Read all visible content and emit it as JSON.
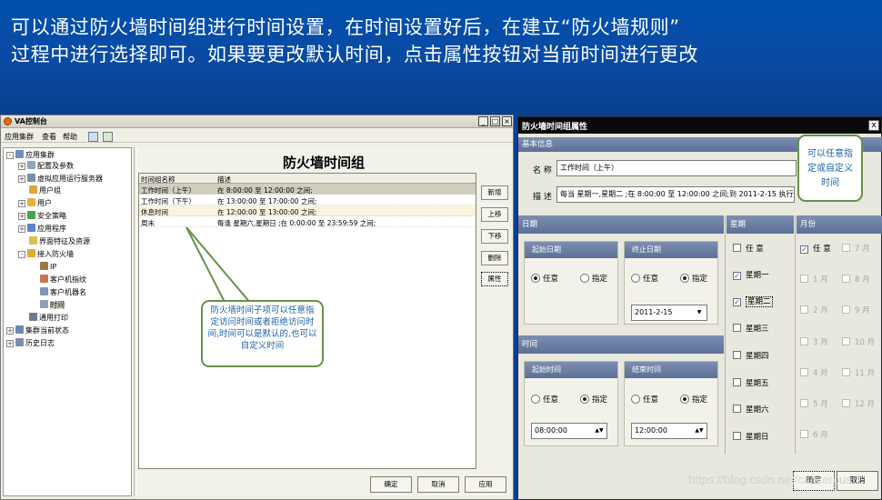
{
  "slide": {
    "line1": "可以通过防火墙时间组进行时间设置，在时间设置好后，在建立“防火墙规则”",
    "line2": "过程中进行选择即可。如果要更改默认时间，点击属性按钮对当前时间进行更改"
  },
  "console": {
    "title": "VA控制台",
    "window_buttons": {
      "min": "_",
      "max": "□",
      "close": "×"
    },
    "menu": [
      "应用集群",
      "查看",
      "帮助"
    ],
    "tree": [
      {
        "label": "应用集群"
      },
      {
        "label": "配置及参数"
      },
      {
        "label": "虚拟应用运行服务器"
      },
      {
        "label": "用户组"
      },
      {
        "label": "用户"
      },
      {
        "label": "安全策略"
      },
      {
        "label": "应用程序"
      },
      {
        "label": "界面特征及资源"
      },
      {
        "label": "接入防火墙"
      },
      {
        "label": "IP"
      },
      {
        "label": "客户机指纹"
      },
      {
        "label": "客户机器名"
      },
      {
        "label": "时间"
      },
      {
        "label": "通用打印"
      },
      {
        "label": "集群当前状态"
      },
      {
        "label": "历史日志"
      }
    ],
    "panel_title": "防火墙时间组",
    "columns": [
      "时间组名称",
      "描述"
    ],
    "rows": [
      {
        "name": "工作时间（上午）",
        "desc": "在 8:00:00 至 12:00:00 之间;"
      },
      {
        "name": "工作时间（下午）",
        "desc": "在 13:00:00 至 17:00:00 之间;"
      },
      {
        "name": "休息时间",
        "desc": "在 12:00:00 至 13:00:00 之间;"
      },
      {
        "name": "周末",
        "desc": "每逢 星期六,星期日 ;在 0:00:00 至 23:59:59 之间;"
      }
    ],
    "side_buttons": [
      "新增",
      "上移",
      "下移",
      "删除",
      "属性"
    ],
    "bottom_buttons": [
      "确定",
      "取消",
      "应用"
    ],
    "callout": "防火墙时间子项可以任意指定访问时间或者拒绝访问时间,时间可以是默认的,也可以自定义时间"
  },
  "dialog": {
    "title": "防火墙时间组属性",
    "close": "x",
    "basic_section": "基本信息",
    "name_label": "名 称",
    "name_value": "工作时间（上午）",
    "desc_label": "描 述",
    "desc_value": "每当 星期一,星期二 ;在 8:00:00 至 12:00:00 之间;到 2011-2-15 执行结束;",
    "date_section": "日期",
    "start_date_group": "起始日期",
    "end_date_group": "终止日期",
    "time_section": "时间",
    "start_time_group": "起始时间",
    "end_time_group": "结束时间",
    "opt_any": "任意",
    "opt_specify": "指定",
    "end_date_value": "2011-2-15",
    "start_time_value": "08:00:00",
    "end_time_value": "12:00:00",
    "week_section": "星期",
    "weekdays": [
      {
        "label": "任 意",
        "checked": false
      },
      {
        "label": "星期一",
        "checked": true
      },
      {
        "label": "星期二",
        "checked": true
      },
      {
        "label": "星期三",
        "checked": false
      },
      {
        "label": "星期四",
        "checked": false
      },
      {
        "label": "星期五",
        "checked": false
      },
      {
        "label": "星期六",
        "checked": false
      },
      {
        "label": "星期日",
        "checked": false
      }
    ],
    "month_section": "月份",
    "months_col1": [
      {
        "label": "任 意",
        "checked": true
      },
      {
        "label": "1 月"
      },
      {
        "label": "2 月"
      },
      {
        "label": "3 月"
      },
      {
        "label": "4 月"
      },
      {
        "label": "5 月"
      },
      {
        "label": "6 月"
      }
    ],
    "months_col2": [
      {
        "label": "7 月"
      },
      {
        "label": "8 月"
      },
      {
        "label": "9 月"
      },
      {
        "label": "10 月"
      },
      {
        "label": "11 月"
      },
      {
        "label": "12 月"
      }
    ],
    "ok": "确定",
    "cancel": "取消",
    "callout": "可以任意指定或自定义时间"
  },
  "watermark": "https://blog.csdn.net/cancerous"
}
